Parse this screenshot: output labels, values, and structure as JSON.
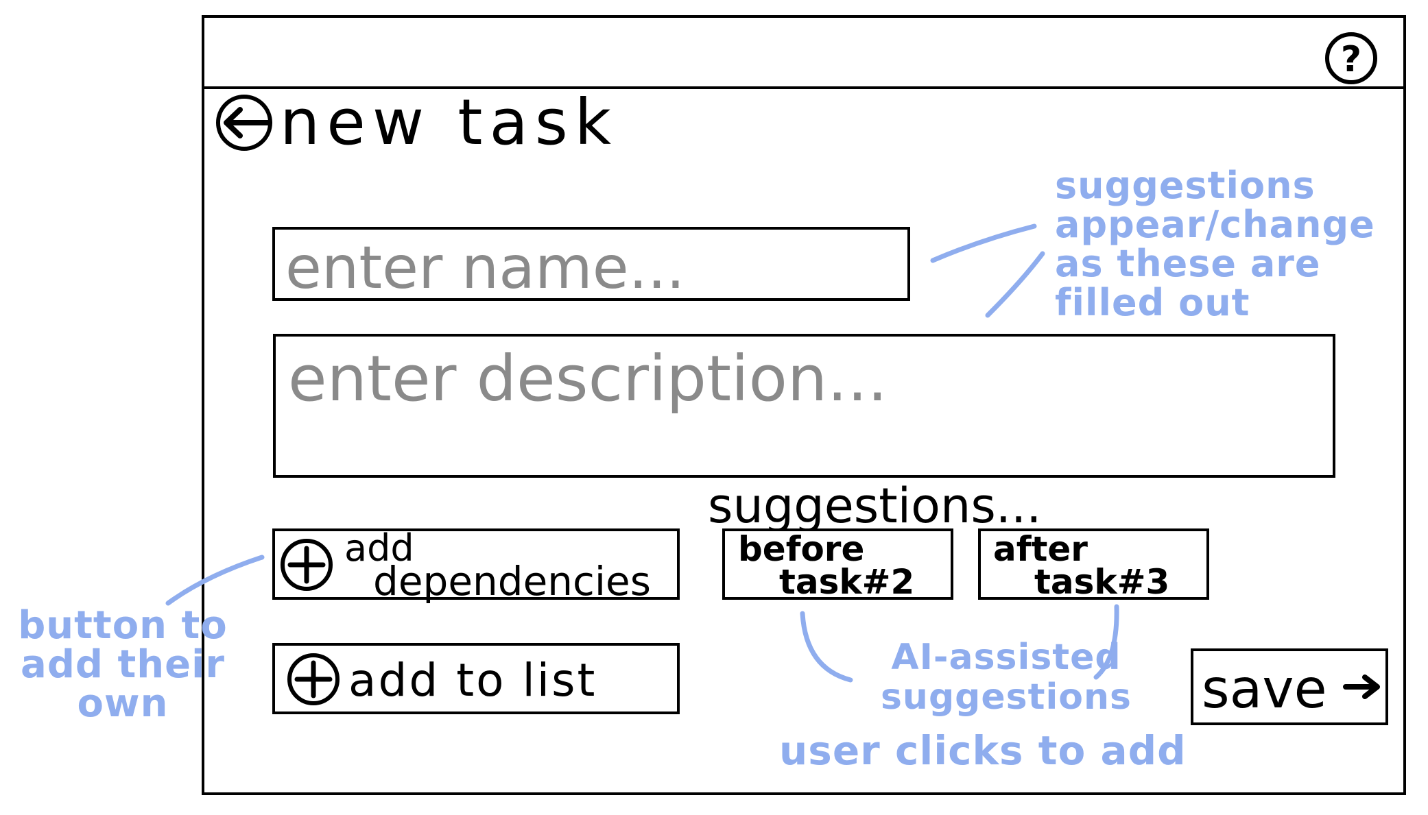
{
  "header": {
    "help_icon": "question-circle-icon",
    "back_icon": "arrow-left-circle-icon",
    "title": "new task"
  },
  "form": {
    "name_placeholder": "enter name...",
    "description_placeholder": "enter description..."
  },
  "actions": {
    "add_dependencies_line1": "add",
    "add_dependencies_line2": "dependencies",
    "add_to_list": "add to list",
    "save": "save",
    "plus_icon": "plus-circle-icon",
    "arrow_icon": "arrow-right-icon"
  },
  "suggestions": {
    "heading": "suggestions...",
    "items": [
      {
        "line1": "before",
        "line2": "task#2"
      },
      {
        "line1": "after",
        "line2": "task#3"
      }
    ]
  },
  "annotations": {
    "suggestions_change": [
      "suggestions",
      "appear/change",
      "as these are",
      "filled out"
    ],
    "button_own": [
      "button to",
      "add their",
      "own"
    ],
    "ai_assisted": [
      "AI-assisted",
      "suggestions"
    ],
    "user_clicks": "user clicks to add"
  },
  "colors": {
    "ink": "#000000",
    "placeholder": "#8a8a8a",
    "annotation": "#8fadee",
    "background": "#ffffff"
  }
}
